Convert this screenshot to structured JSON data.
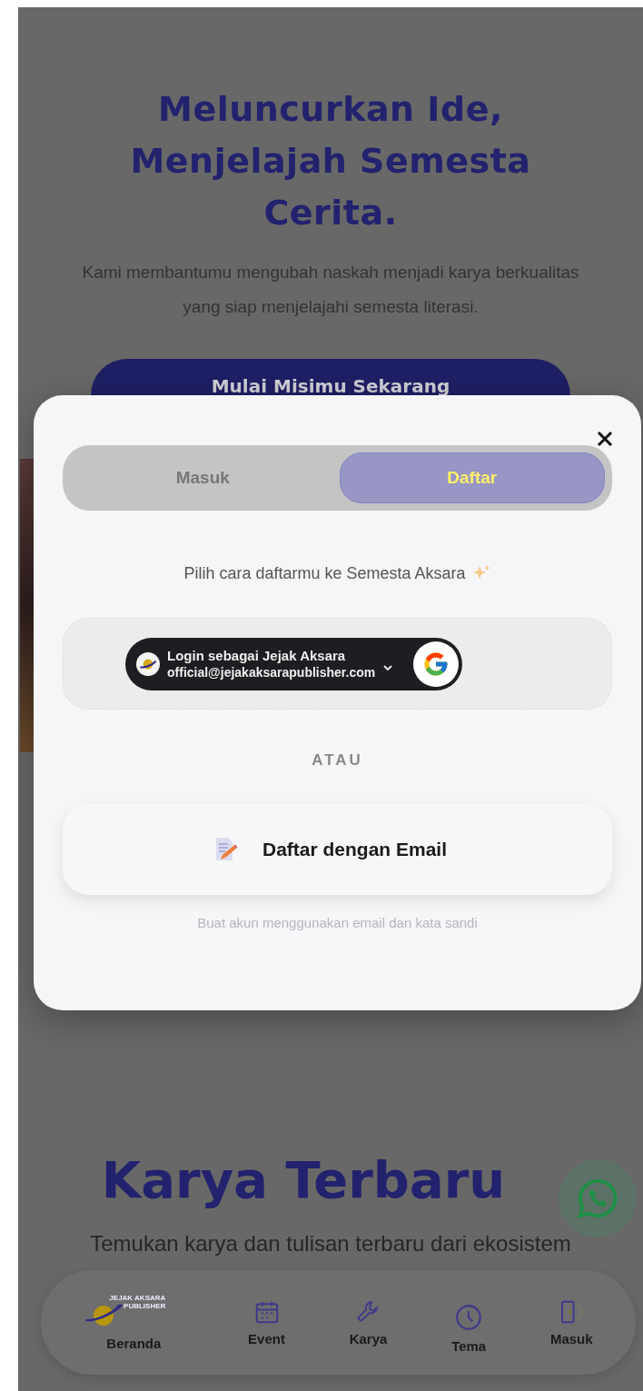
{
  "hero": {
    "title_lines": [
      "Meluncurkan Ide,",
      "Menjelajah Semesta",
      "Cerita."
    ],
    "subtitle": "Kami membantumu mengubah naskah menjadi karya berkualitas yang siap menjelajahi semesta literasi.",
    "cta": "Mulai Misimu Sekarang"
  },
  "modal": {
    "tabs": [
      {
        "label": "Masuk",
        "selected": false
      },
      {
        "label": "Daftar",
        "selected": true
      }
    ],
    "prompt": "Pilih cara daftarmu ke Semesta Aksara",
    "google_button": {
      "title": "Login sebagai Jejak Aksara",
      "email": "official@jejakaksarapublisher.com"
    },
    "divider": "ATAU",
    "email_button": "Daftar dengan Email",
    "email_hint": "Buat akun menggunakan email dan kata sandi"
  },
  "section": {
    "title": "Karya Terbaru",
    "subtitle": "Temukan karya dan tulisan terbaru dari ekosistem"
  },
  "bottom_nav": {
    "logo_lines": [
      "JEJAK AKSARA",
      "PUBLISHER"
    ],
    "items": [
      {
        "label": "Beranda"
      },
      {
        "label": "Event"
      },
      {
        "label": "Karya"
      },
      {
        "label": "Tema"
      },
      {
        "label": "Masuk"
      }
    ]
  }
}
